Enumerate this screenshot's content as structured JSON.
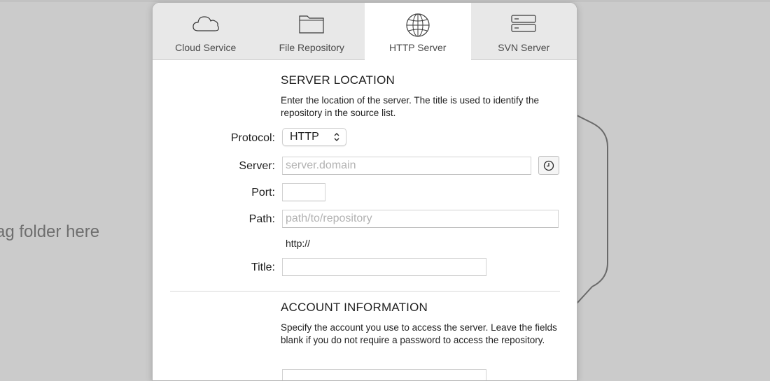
{
  "background": {
    "drop_hint": "ag folder here"
  },
  "tabs": [
    {
      "label": "Cloud Service",
      "icon": "cloud-icon",
      "active": false
    },
    {
      "label": "File Repository",
      "icon": "folder-icon",
      "active": false
    },
    {
      "label": "HTTP Server",
      "icon": "globe-icon",
      "active": true
    },
    {
      "label": "SVN Server",
      "icon": "server-icon",
      "active": false
    }
  ],
  "server_location": {
    "title": "SERVER LOCATION",
    "description": "Enter the location of the server. The title is used to identify the repository in the source list.",
    "protocol_label": "Protocol:",
    "protocol_value": "HTTP",
    "server_label": "Server:",
    "server_placeholder": "server.domain",
    "server_value": "",
    "port_label": "Port:",
    "port_value": "",
    "path_label": "Path:",
    "path_placeholder": "path/to/repository",
    "path_value": "",
    "url_preview": "http://",
    "title_label": "Title:",
    "title_value": ""
  },
  "account_information": {
    "title": "ACCOUNT INFORMATION",
    "description": "Specify the account you use to access the server. Leave the fields blank if you do not require a password to access the repository."
  },
  "colors": {
    "background": "#cbcbcb",
    "tabbar": "#e8e8e8",
    "active_tab": "#ffffff",
    "text": "#1f1f1f",
    "placeholder": "#b2b2b2"
  }
}
